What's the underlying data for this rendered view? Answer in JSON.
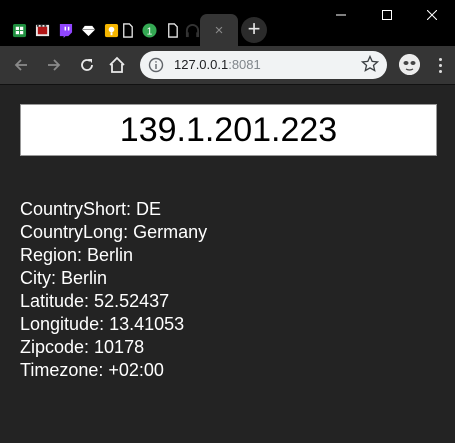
{
  "browser": {
    "tabs": [
      {
        "icon": "spreadsheet-icon",
        "color": "#1e8e3e"
      },
      {
        "icon": "film-icon",
        "color": "#e8e8e8"
      },
      {
        "icon": "twitch-icon",
        "color": "#9146ff"
      },
      {
        "icon": "diamond-icon",
        "color": "#ffffff"
      },
      {
        "icon": "lightbulb-icon",
        "color": "#f6b600"
      },
      {
        "icon": "document-icon",
        "color": "#e8e8e8"
      },
      {
        "icon": "notification-icon",
        "badge": "1",
        "color": "#34a853"
      },
      {
        "icon": "document-icon",
        "color": "#e8e8e8"
      },
      {
        "icon": "headphones-icon",
        "color": "#333333"
      }
    ],
    "active_tab_close": "×",
    "new_tab": "+",
    "window": {
      "minimize": "–",
      "maximize": "☐",
      "close": "✕"
    },
    "address": {
      "host": "127.0.0.1",
      "port": ":8081"
    }
  },
  "page": {
    "ip": "139.1.201.223",
    "fields": [
      "CountryShort: DE",
      "CountryLong: Germany",
      "Region: Berlin",
      "City: Berlin",
      "Latitude: 52.52437",
      "Longitude: 13.41053",
      "Zipcode: 10178",
      "Timezone: +02:00"
    ]
  }
}
